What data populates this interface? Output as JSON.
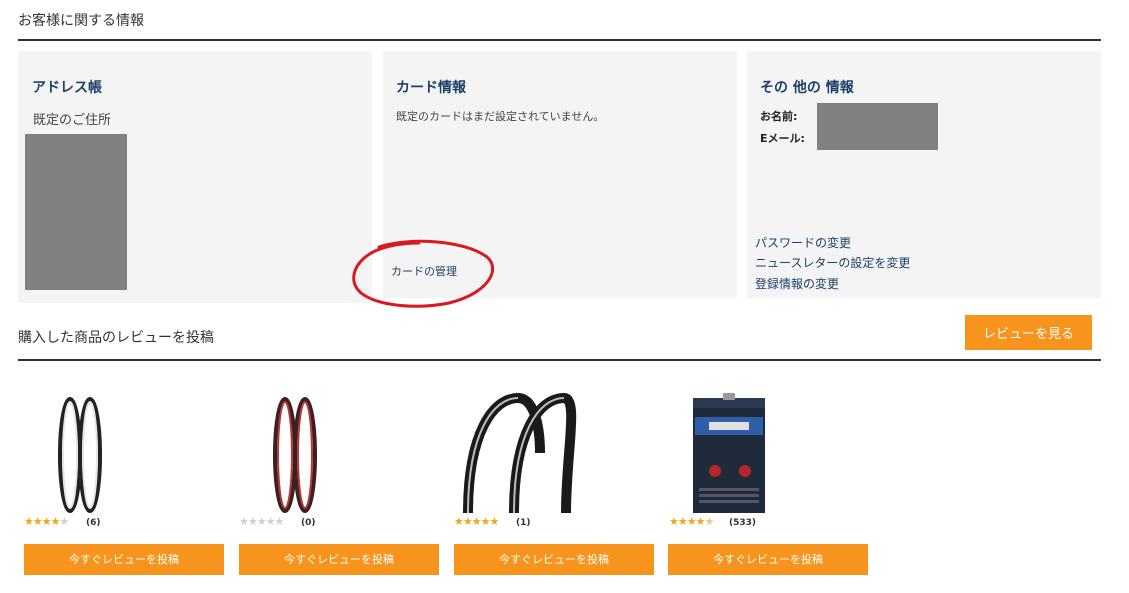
{
  "customer_info": {
    "heading": "お客様に関する情報",
    "address_book": {
      "title": "アドレス帳",
      "default_address_label": "既定のご住所"
    },
    "card_info": {
      "title": "カード情報",
      "message": "既定のカードはまだ設定されていません。",
      "manage_link": "カードの管理"
    },
    "other_info": {
      "title": "その 他の 情報",
      "name_label": "お名前:",
      "email_label": "Eメール:",
      "links": [
        "パスワードの変更",
        "ニュースレターの設定を変更",
        "登録情報の変更"
      ]
    }
  },
  "reviews": {
    "heading": "購入した商品のレビューを投稿",
    "view_button": "レビューを見る",
    "products": [
      {
        "stars": 4,
        "count": "(6)",
        "button": "今すぐレビューを投稿",
        "icon": "road-tire-black-white-icon"
      },
      {
        "stars": 0,
        "count": "(0)",
        "button": "今すぐレビューを投稿",
        "icon": "road-tire-red-icon"
      },
      {
        "stars": 5,
        "count": "(1)",
        "button": "今すぐレビューを投稿",
        "icon": "road-tire-wide-icon"
      },
      {
        "stars": 4.5,
        "count": "(533)",
        "button": "今すぐレビューを投稿",
        "icon": "inner-tube-box-icon"
      }
    ]
  },
  "colors": {
    "accent": "#f7941d",
    "panel_title": "#1c3f66",
    "panel_bg": "#f4f4f5",
    "annotation": "#d9181f"
  }
}
